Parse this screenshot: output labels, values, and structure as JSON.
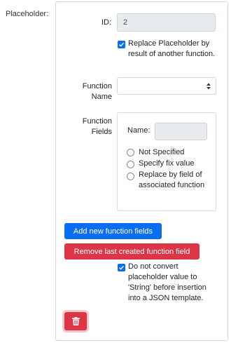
{
  "placeholder_label": "Placeholder:",
  "id_field": {
    "label": "ID:",
    "value": "2"
  },
  "replace_checkbox": {
    "checked": true,
    "label": "Replace Placeholder by result of another function."
  },
  "function_name": {
    "label": "Function Name",
    "selected": ""
  },
  "function_fields": {
    "label": "Function Fields",
    "name_label": "Name:",
    "name_value": "",
    "options": [
      {
        "label": "Not Specified"
      },
      {
        "label": "Specify fix value"
      },
      {
        "label": "Replace by field of associated function"
      }
    ]
  },
  "buttons": {
    "add_label": "Add new function fields",
    "remove_label": "Remove last created function field"
  },
  "json_checkbox": {
    "checked": true,
    "label": "Do not convert placeholder value to 'String' before insertion into a JSON template."
  },
  "colors": {
    "primary": "#0b6ef2",
    "danger": "#dc3545"
  },
  "icons": {
    "delete": "trash-icon",
    "select_arrow": "sort-arrows-icon",
    "check": "check-icon"
  }
}
